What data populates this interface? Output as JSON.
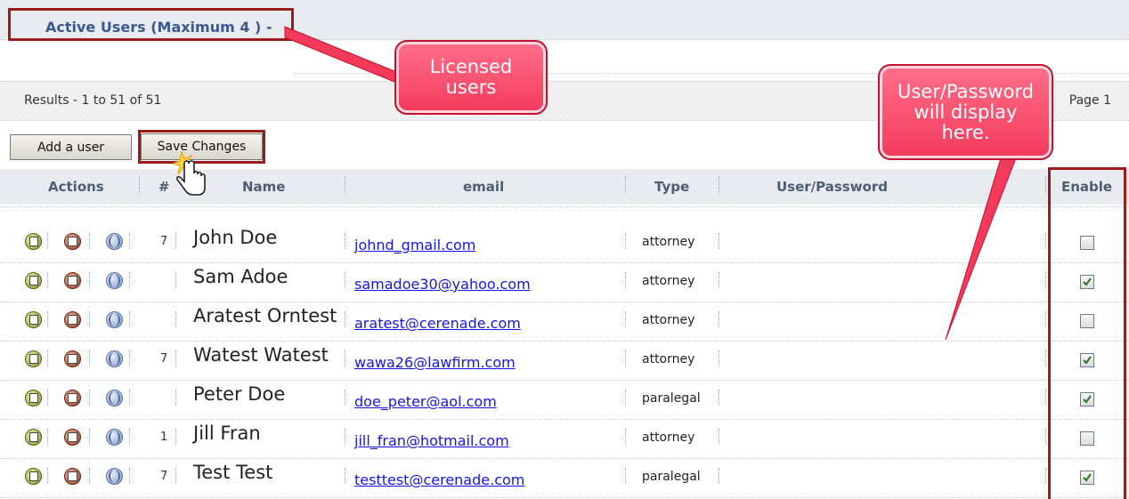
{
  "title": "Active Users (Maximum 4 ) -",
  "results": "Results - 1 to 51 of 51",
  "page": "Page 1",
  "buttons": {
    "add": "Add a user",
    "save": "Save Changes"
  },
  "headers": {
    "actions": "Actions",
    "num": "#",
    "name": "Name",
    "email": "email",
    "type": "Type",
    "user_password": "User/Password",
    "enable": "Enable"
  },
  "callouts": {
    "licensed": "Licensed\nusers",
    "user_password": "User/Password\nwill display\nhere."
  },
  "rows": [
    {
      "num": "7",
      "name": "John Doe",
      "email": "johnd_gmail.com",
      "type": "attorney",
      "enabled": false
    },
    {
      "num": "",
      "name": "Sam Adoe",
      "email": "samadoe30@yahoo.com",
      "type": "attorney",
      "enabled": true
    },
    {
      "num": "",
      "name": "Aratest Orntest",
      "email": "aratest@cerenade.com",
      "type": "attorney",
      "enabled": false
    },
    {
      "num": "7",
      "name": "Watest Watest",
      "email": "wawa26@lawfirm.com",
      "type": "attorney",
      "enabled": true
    },
    {
      "num": "",
      "name": "Peter Doe",
      "email": "doe_peter@aol.com",
      "type": "paralegal",
      "enabled": true
    },
    {
      "num": "1",
      "name": "Jill Fran",
      "email": "jill_fran@hotmail.com",
      "type": "attorney",
      "enabled": false
    },
    {
      "num": "7",
      "name": "Test Test",
      "email": "testtest@cerenade.com",
      "type": "paralegal",
      "enabled": true
    }
  ],
  "colors": {
    "annotation_border": "#9e1b1b",
    "callout_fill": "#f43a5b",
    "link": "#1515e8",
    "header_text": "#4d5d74"
  },
  "icons": [
    "edit-icon",
    "delete-icon",
    "globe-icon",
    "pointer-hand-icon",
    "checkmark-icon"
  ]
}
